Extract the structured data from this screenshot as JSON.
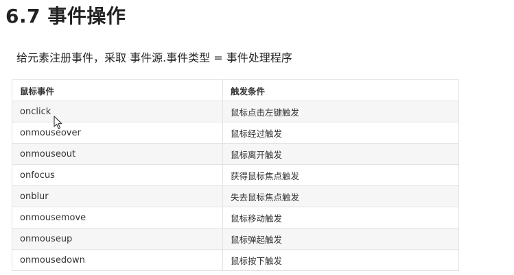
{
  "heading": "6.7 事件操作",
  "intro": "给元素注册事件，采取  事件源.事件类型 = 事件处理程序",
  "table": {
    "headers": [
      "鼠标事件",
      "触发条件"
    ],
    "rows": [
      {
        "event": "onclick",
        "condition": "鼠标点击左键触发"
      },
      {
        "event": "onmouseover",
        "condition": "鼠标经过触发"
      },
      {
        "event": "onmouseout",
        "condition": "鼠标离开触发"
      },
      {
        "event": "onfocus",
        "condition": "获得鼠标焦点触发"
      },
      {
        "event": "onblur",
        "condition": "失去鼠标焦点触发"
      },
      {
        "event": "onmousemove",
        "condition": "鼠标移动触发"
      },
      {
        "event": "onmouseup",
        "condition": "鼠标弹起触发"
      },
      {
        "event": "onmousedown",
        "condition": "鼠标按下触发"
      }
    ]
  },
  "cursor": {
    "icon": "arrow-cursor-icon"
  }
}
